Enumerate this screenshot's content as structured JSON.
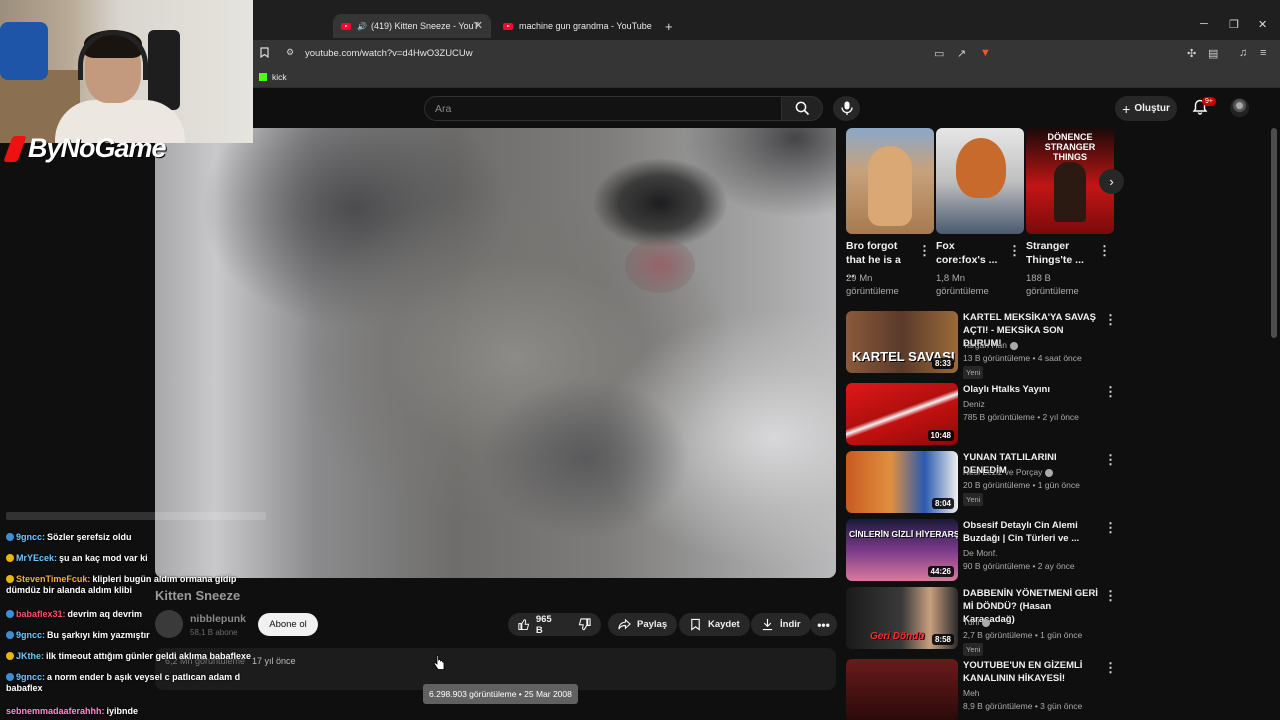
{
  "browser": {
    "tabs": [
      {
        "title": "(419) Kitten Sneeze - YouTube",
        "active": true
      },
      {
        "title": "machine gun grandma - YouTube",
        "active": false
      }
    ],
    "url": "youtube.com/watch?v=d4HwO3ZUCUw",
    "bookmarks": [
      "kick"
    ]
  },
  "header": {
    "search_placeholder": "Ara",
    "create_label": "Oluştur",
    "notif_badge": "9+"
  },
  "video": {
    "title": "Kitten Sneeze",
    "channel": "nibblepunk",
    "subscribers": "58,1 B abone",
    "subscribe_label": "Abone ol",
    "likes": "965 B",
    "share_label": "Paylaş",
    "save_label": "Kaydet",
    "download_label": "İndir",
    "desc_views": "6,2 Mn görüntüleme",
    "desc_ago": "17 yıl önce",
    "tooltip": "6.298.903 görüntüleme • 25 Mar 2008"
  },
  "shorts": [
    {
      "title": "Bro forgot that he is a ...",
      "views": "29 Mn görüntüleme",
      "color": "#b98a5e"
    },
    {
      "title": "Fox core:fox's ...",
      "views": "1,8 Mn görüntüleme",
      "color": "#c46a2c"
    },
    {
      "title": "Stranger Things'te ...",
      "views": "188 B görüntüleme",
      "color": "#c21515",
      "thumb_text": "DÖNENCE STRANGER THINGS"
    }
  ],
  "related": [
    {
      "title": "KARTEL MEKSİKA'YA SAVAŞ AÇTI! - MEKSİKA SON DURUM!",
      "channel": "Targan Han",
      "verified": true,
      "meta": "13 B görüntüleme • 4 saat önce",
      "badge": "Yeni",
      "duration": "8:33",
      "thumb_text": "KARTEL SAVAŞI",
      "color": "#7a3a2a"
    },
    {
      "title": "Olaylı Htalks Yayını",
      "channel": "Deniz",
      "verified": false,
      "meta": "785 B görüntüleme • 2 yıl önce",
      "badge": "",
      "duration": "10:48",
      "thumb_text": "",
      "color": "#d01818"
    },
    {
      "title": "YUNAN TATLILARINI DENEDİM",
      "channel": "Nesi Leziz ve Porçay",
      "verified": true,
      "meta": "20 B görüntüleme • 1 gün önce",
      "badge": "Yeni",
      "duration": "8:04",
      "thumb_text": "",
      "color": "#c86020"
    },
    {
      "title": "Obsesif Detaylı Cin Alemi Buzdağı | Cin Türleri ve ...",
      "channel": "De Monf.",
      "verified": false,
      "meta": "90 B görüntüleme • 2 ay önce",
      "badge": "",
      "duration": "44:26",
      "thumb_text": "CİNLERİN GİZLİ HİYERARŞİSİ",
      "color": "#5a2a6a"
    },
    {
      "title": "DABBENİN YÖNETMENİ GERİ Mİ DÖNDÜ? (Hasan Karacadağ)",
      "channel": "Tuni",
      "verified": true,
      "meta": "2,7 B görüntüleme • 1 gün önce",
      "badge": "Yeni",
      "duration": "8:58",
      "thumb_text": "Geri Döndü",
      "color": "#2a2a2a"
    },
    {
      "title": "YOUTUBE'UN EN GİZEMLİ KANALININ HİKAYESİ!",
      "channel": "Meh",
      "verified": false,
      "meta": "8,9 B görüntüleme • 3 gün önce",
      "badge": "",
      "duration": "",
      "thumb_text": "",
      "color": "#3a0a0a"
    }
  ],
  "overlay": {
    "logo": "ByNoGame",
    "chat": [
      {
        "user": "9gncc:",
        "text": "Sözler şerefsiz oldu",
        "color": "#6ec6ff",
        "icon": "#3a8fd8"
      },
      {
        "user": "MrYEcek:",
        "text": "şu an kaç mod var ki",
        "color": "#6ec6ff",
        "icon": "#e6b800"
      },
      {
        "user": "StevenTimeFcuk:",
        "text": "klipleri bugün aldım ormana gidip dümdüz bir alanda aldım klibi",
        "color": "#f0b040",
        "icon": "#e6b800"
      },
      {
        "user": "babaflex31:",
        "text": "devrim aq devrim",
        "color": "#ff4d6d",
        "icon": "#3a8fd8"
      },
      {
        "user": "9gncc:",
        "text": "Bu şarkıyı kim yazmıştır",
        "color": "#6ec6ff",
        "icon": "#3a8fd8"
      },
      {
        "user": "JKthe:",
        "text": "ilk timeout attığım günler geldi aklıma babaflexe",
        "color": "#6ec6ff",
        "icon": "#e6b800"
      },
      {
        "user": "9gncc:",
        "text": "a norm ender b aşık veysel c patlıcan adam d babaflex",
        "color": "#6ec6ff",
        "icon": "#3a8fd8"
      },
      {
        "user": "sebnemmadaaferahhh:",
        "text": "iyibnde",
        "color": "#ff8ad0",
        "icon": ""
      }
    ]
  }
}
